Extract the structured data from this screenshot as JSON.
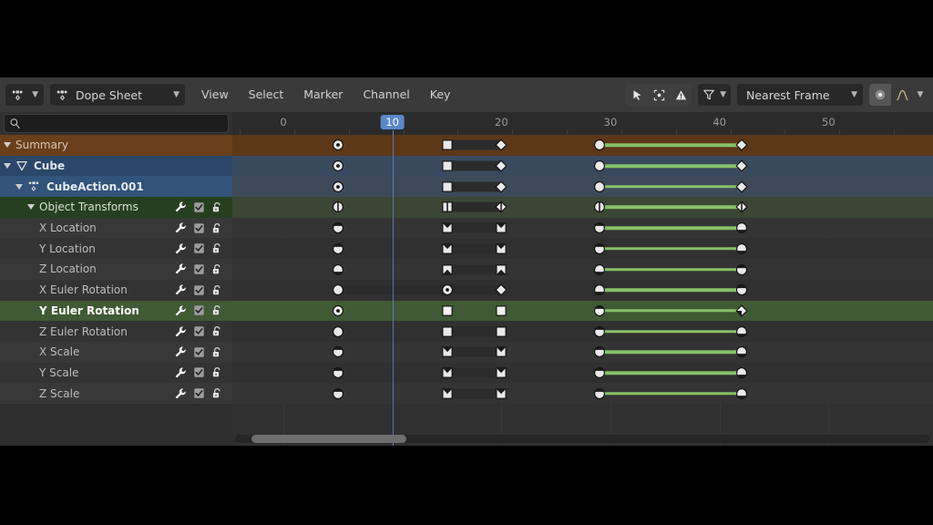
{
  "editor": {
    "type_label": "Dope Sheet",
    "mode_icon": "dopesheet-icon",
    "menus": [
      "View",
      "Select",
      "Marker",
      "Channel",
      "Key"
    ],
    "toolbar_right": {
      "cursor_icon": "cursor-select-icon",
      "proportional_icon": "proportional-edit-icon",
      "warning_icon": "warning-icon",
      "filter_icon": "filter-funnel-icon",
      "snap_value": "Nearest Frame",
      "snap_toggle_icon": "snap-magnet-icon",
      "falloff_icon": "proportional-falloff-icon"
    }
  },
  "search": {
    "value": "",
    "placeholder": "",
    "icon": "search-icon"
  },
  "ruler": {
    "ticks": [
      {
        "label": "0",
        "frame": 0,
        "current": false
      },
      {
        "label": "10",
        "frame": 10,
        "current": true
      },
      {
        "label": "20",
        "frame": 20,
        "current": false
      },
      {
        "label": "30",
        "frame": 30,
        "current": false
      },
      {
        "label": "40",
        "frame": 40,
        "current": false
      },
      {
        "label": "50",
        "frame": 50,
        "current": false
      }
    ],
    "current_frame": 10,
    "frame_min": -4,
    "frame_max": 60
  },
  "channels": [
    {
      "name": "Summary",
      "indent": 0,
      "expanded": true,
      "type": "summary",
      "color": "#6a3f1c",
      "text_color": "#d9c6b4",
      "has_icons": false,
      "selected": false,
      "icon": null
    },
    {
      "name": "Cube",
      "indent": 0,
      "expanded": true,
      "type": "object",
      "color": "#2b4668",
      "text_color": "#dbe4ef",
      "has_icons": false,
      "selected": true,
      "icon": "mesh-object-icon"
    },
    {
      "name": "CubeAction.001",
      "indent": 1,
      "expanded": true,
      "type": "action",
      "color": "#32537a",
      "text_color": "#e2eaf3",
      "has_icons": false,
      "selected": true,
      "icon": "action-icon"
    },
    {
      "name": "Object Transforms",
      "indent": 2,
      "expanded": true,
      "type": "group",
      "color": "#26401f",
      "text_color": "#d6e3cf",
      "has_icons": true,
      "selected": false,
      "icon": null
    },
    {
      "name": "X Location",
      "indent": 3,
      "expanded": null,
      "type": "fcurve",
      "color": "#383838",
      "text_color": "#bdbdbd",
      "has_icons": true,
      "selected": false,
      "icon": null
    },
    {
      "name": "Y Location",
      "indent": 3,
      "expanded": null,
      "type": "fcurve",
      "color": "#333333",
      "text_color": "#bdbdbd",
      "has_icons": true,
      "selected": false,
      "icon": null
    },
    {
      "name": "Z Location",
      "indent": 3,
      "expanded": null,
      "type": "fcurve",
      "color": "#383838",
      "text_color": "#bdbdbd",
      "has_icons": true,
      "selected": false,
      "icon": null
    },
    {
      "name": "X Euler Rotation",
      "indent": 3,
      "expanded": null,
      "type": "fcurve",
      "color": "#333333",
      "text_color": "#bdbdbd",
      "has_icons": true,
      "selected": false,
      "icon": null
    },
    {
      "name": "Y Euler Rotation",
      "indent": 3,
      "expanded": null,
      "type": "fcurve",
      "color": "#3f5a34",
      "text_color": "#ffffff",
      "has_icons": true,
      "selected": true,
      "icon": null
    },
    {
      "name": "Z Euler Rotation",
      "indent": 3,
      "expanded": null,
      "type": "fcurve",
      "color": "#333333",
      "text_color": "#bdbdbd",
      "has_icons": true,
      "selected": false,
      "icon": null
    },
    {
      "name": "X Scale",
      "indent": 3,
      "expanded": null,
      "type": "fcurve",
      "color": "#383838",
      "text_color": "#bdbdbd",
      "has_icons": true,
      "selected": false,
      "icon": null
    },
    {
      "name": "Y Scale",
      "indent": 3,
      "expanded": null,
      "type": "fcurve",
      "color": "#333333",
      "text_color": "#bdbdbd",
      "has_icons": true,
      "selected": false,
      "icon": null
    },
    {
      "name": "Z Scale",
      "indent": 3,
      "expanded": null,
      "type": "fcurve",
      "color": "#383838",
      "text_color": "#bdbdbd",
      "has_icons": true,
      "selected": false,
      "icon": null
    }
  ],
  "channel_icons": {
    "wrench": "modifier-wrench-icon",
    "checkbox": "enable-checkbox-icon",
    "lock": "unlocked-padlock-icon"
  },
  "keyframe_tracks": [
    {
      "channel": "Summary",
      "row_color": "#5c3819",
      "keys": [
        {
          "frame": 5,
          "shape": "circle-dot",
          "selected": false
        },
        {
          "frame": 15,
          "shape": "square",
          "selected": false
        },
        {
          "frame": 20,
          "shape": "diamond",
          "selected": false
        },
        {
          "frame": 29,
          "shape": "circle",
          "selected": false
        },
        {
          "frame": 42,
          "shape": "diamond",
          "selected": false
        }
      ],
      "segments": [
        {
          "from": 15,
          "to": 20
        }
      ],
      "holds": [
        {
          "from": 29,
          "to": 42
        }
      ]
    },
    {
      "channel": "Cube",
      "row_color": "#3a4a5e",
      "keys": [
        {
          "frame": 5,
          "shape": "circle-dot",
          "selected": false
        },
        {
          "frame": 15,
          "shape": "square",
          "selected": false
        },
        {
          "frame": 20,
          "shape": "diamond",
          "selected": false
        },
        {
          "frame": 29,
          "shape": "circle",
          "selected": false
        },
        {
          "frame": 42,
          "shape": "diamond",
          "selected": false
        }
      ],
      "segments": [
        {
          "from": 15,
          "to": 20
        }
      ],
      "holds": [
        {
          "from": 29,
          "to": 42
        }
      ]
    },
    {
      "channel": "CubeAction.001",
      "row_color": "#3c4a5a",
      "keys": [
        {
          "frame": 5,
          "shape": "circle-dot",
          "selected": false
        },
        {
          "frame": 15,
          "shape": "square",
          "selected": false
        },
        {
          "frame": 20,
          "shape": "diamond",
          "selected": false
        },
        {
          "frame": 29,
          "shape": "circle",
          "selected": false
        },
        {
          "frame": 42,
          "shape": "diamond",
          "selected": false
        }
      ],
      "segments": [
        {
          "from": 15,
          "to": 20
        }
      ],
      "holds": [
        {
          "from": 29,
          "to": 42
        }
      ]
    },
    {
      "channel": "Object Transforms",
      "row_color": "#3c4635",
      "keys": [
        {
          "frame": 5,
          "shape": "circle-split",
          "selected": false
        },
        {
          "frame": 15,
          "shape": "square-split",
          "selected": false
        },
        {
          "frame": 20,
          "shape": "diamond-split",
          "selected": false
        },
        {
          "frame": 29,
          "shape": "circle-split",
          "selected": false
        },
        {
          "frame": 42,
          "shape": "diamond-split",
          "selected": false
        }
      ],
      "segments": [
        {
          "from": 15,
          "to": 20
        }
      ],
      "holds": [
        {
          "from": 29,
          "to": 42
        }
      ]
    },
    {
      "channel": "X Location",
      "row_color": "#343434",
      "keys": [
        {
          "frame": 5,
          "shape": "circle-lower",
          "selected": false
        },
        {
          "frame": 15,
          "shape": "square-upper",
          "selected": false
        },
        {
          "frame": 20,
          "shape": "square-upper",
          "selected": false
        },
        {
          "frame": 29,
          "shape": "circle-lower",
          "selected": false
        },
        {
          "frame": 42,
          "shape": "circle-upper",
          "selected": false
        }
      ],
      "segments": [
        {
          "from": 15,
          "to": 20
        }
      ],
      "holds": [
        {
          "from": 29,
          "to": 42
        }
      ]
    },
    {
      "channel": "Y Location",
      "row_color": "#303030",
      "keys": [
        {
          "frame": 5,
          "shape": "circle-lower",
          "selected": false
        },
        {
          "frame": 15,
          "shape": "square-upper",
          "selected": false
        },
        {
          "frame": 20,
          "shape": "square-upper",
          "selected": false
        },
        {
          "frame": 29,
          "shape": "circle-lower",
          "selected": false
        },
        {
          "frame": 42,
          "shape": "circle-upper",
          "selected": false
        }
      ],
      "segments": [
        {
          "from": 15,
          "to": 20
        }
      ],
      "holds": [
        {
          "from": 29,
          "to": 42
        }
      ]
    },
    {
      "channel": "Z Location",
      "row_color": "#343434",
      "keys": [
        {
          "frame": 5,
          "shape": "circle-upper",
          "selected": false
        },
        {
          "frame": 15,
          "shape": "square-lower",
          "selected": false
        },
        {
          "frame": 20,
          "shape": "square-lower",
          "selected": false
        },
        {
          "frame": 29,
          "shape": "circle-upper",
          "selected": false
        },
        {
          "frame": 42,
          "shape": "diamond-lower",
          "selected": false
        }
      ],
      "segments": [
        {
          "from": 15,
          "to": 20
        }
      ],
      "holds": [
        {
          "from": 29,
          "to": 42
        }
      ]
    },
    {
      "channel": "X Euler Rotation",
      "row_color": "#303030",
      "keys": [
        {
          "frame": 5,
          "shape": "circle",
          "selected": false
        },
        {
          "frame": 15,
          "shape": "circle-dot",
          "selected": false
        },
        {
          "frame": 20,
          "shape": "diamond",
          "selected": false
        },
        {
          "frame": 29,
          "shape": "circle-upper",
          "selected": false
        },
        {
          "frame": 42,
          "shape": "diamond-lower",
          "selected": false
        }
      ],
      "segments": [
        {
          "from": 5,
          "to": 20
        }
      ],
      "holds": [
        {
          "from": 29,
          "to": 42
        }
      ]
    },
    {
      "channel": "Y Euler Rotation",
      "row_color": "#3f5a34",
      "keys": [
        {
          "frame": 5,
          "shape": "circle-dot",
          "selected": true
        },
        {
          "frame": 15,
          "shape": "square",
          "selected": true
        },
        {
          "frame": 20,
          "shape": "square",
          "selected": true
        },
        {
          "frame": 29,
          "shape": "circle-lower",
          "selected": true
        },
        {
          "frame": 42,
          "shape": "diamond-dark",
          "selected": true
        }
      ],
      "segments": [],
      "holds": [
        {
          "from": 29,
          "to": 42
        }
      ]
    },
    {
      "channel": "Z Euler Rotation",
      "row_color": "#303030",
      "keys": [
        {
          "frame": 5,
          "shape": "circle",
          "selected": false
        },
        {
          "frame": 15,
          "shape": "square",
          "selected": false
        },
        {
          "frame": 20,
          "shape": "square",
          "selected": false
        },
        {
          "frame": 29,
          "shape": "circle-lower",
          "selected": false
        },
        {
          "frame": 42,
          "shape": "circle-upper",
          "selected": false
        }
      ],
      "segments": [
        {
          "from": 15,
          "to": 20
        }
      ],
      "holds": [
        {
          "from": 29,
          "to": 42
        }
      ]
    },
    {
      "channel": "X Scale",
      "row_color": "#343434",
      "keys": [
        {
          "frame": 5,
          "shape": "circle-lower",
          "selected": false
        },
        {
          "frame": 15,
          "shape": "square-upper",
          "selected": false
        },
        {
          "frame": 20,
          "shape": "square-upper",
          "selected": false
        },
        {
          "frame": 29,
          "shape": "circle-lower",
          "selected": false
        },
        {
          "frame": 42,
          "shape": "circle-upper",
          "selected": false
        }
      ],
      "segments": [
        {
          "from": 15,
          "to": 20
        }
      ],
      "holds": [
        {
          "from": 29,
          "to": 42
        }
      ]
    },
    {
      "channel": "Y Scale",
      "row_color": "#303030",
      "keys": [
        {
          "frame": 5,
          "shape": "circle-lower",
          "selected": false
        },
        {
          "frame": 15,
          "shape": "square-upper",
          "selected": false
        },
        {
          "frame": 20,
          "shape": "square-upper",
          "selected": false
        },
        {
          "frame": 29,
          "shape": "circle-lower",
          "selected": false
        },
        {
          "frame": 42,
          "shape": "circle-upper",
          "selected": false
        }
      ],
      "segments": [
        {
          "from": 15,
          "to": 20
        }
      ],
      "holds": [
        {
          "from": 29,
          "to": 42
        }
      ]
    },
    {
      "channel": "Z Scale",
      "row_color": "#343434",
      "keys": [
        {
          "frame": 5,
          "shape": "circle-lower",
          "selected": false
        },
        {
          "frame": 15,
          "shape": "square-upper",
          "selected": false
        },
        {
          "frame": 20,
          "shape": "square-upper",
          "selected": false
        },
        {
          "frame": 29,
          "shape": "circle-lower",
          "selected": false
        },
        {
          "frame": 42,
          "shape": "circle-upper",
          "selected": false
        }
      ],
      "segments": [
        {
          "from": 15,
          "to": 20
        }
      ],
      "holds": [
        {
          "from": 29,
          "to": 42
        }
      ]
    }
  ],
  "scrollbar": {
    "thumb_start_frame": 1,
    "thumb_end_frame": 15
  },
  "edge_chevron": "‹",
  "colors": {
    "header_bg": "#3a3a3a",
    "grid_bg": "#303030",
    "hold_green": "#87c167",
    "playhead_blue": "#5c86c4",
    "current_frame_badge": "#5a87c9",
    "summary_brown": "#5c3819",
    "selected_green": "#3f5a34"
  }
}
